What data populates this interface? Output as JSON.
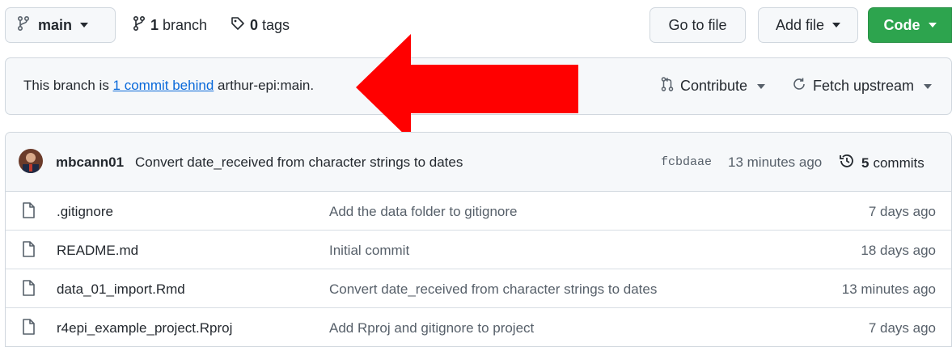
{
  "toolbar": {
    "branch_button": {
      "label": "main",
      "icon": "git-branch-icon"
    },
    "branches": {
      "count": "1",
      "label": "branch"
    },
    "tags": {
      "count": "0",
      "label": "tags"
    },
    "go_to_file": "Go to file",
    "add_file": "Add file",
    "code": "Code",
    "code_color": "#2da44e"
  },
  "behind_banner": {
    "prefix": "This branch is ",
    "link_text": "1 commit behind",
    "suffix": " arthur-epi:main.",
    "contribute": "Contribute",
    "fetch_upstream": "Fetch upstream"
  },
  "annotation": {
    "arrow_color": "#ff0000"
  },
  "latest_commit": {
    "author": "mbcann01",
    "message": "Convert date_received from character strings to dates",
    "sha": "fcbdaae",
    "when": "13 minutes ago",
    "commit_count": "5",
    "commit_label": "commits"
  },
  "files": [
    {
      "name": ".gitignore",
      "message": "Add the data folder to gitignore",
      "age": "7 days ago"
    },
    {
      "name": "README.md",
      "message": "Initial commit",
      "age": "18 days ago"
    },
    {
      "name": "data_01_import.Rmd",
      "message": "Convert date_received from character strings to dates",
      "age": "13 minutes ago"
    },
    {
      "name": "r4epi_example_project.Rproj",
      "message": "Add Rproj and gitignore to project",
      "age": "7 days ago"
    }
  ]
}
